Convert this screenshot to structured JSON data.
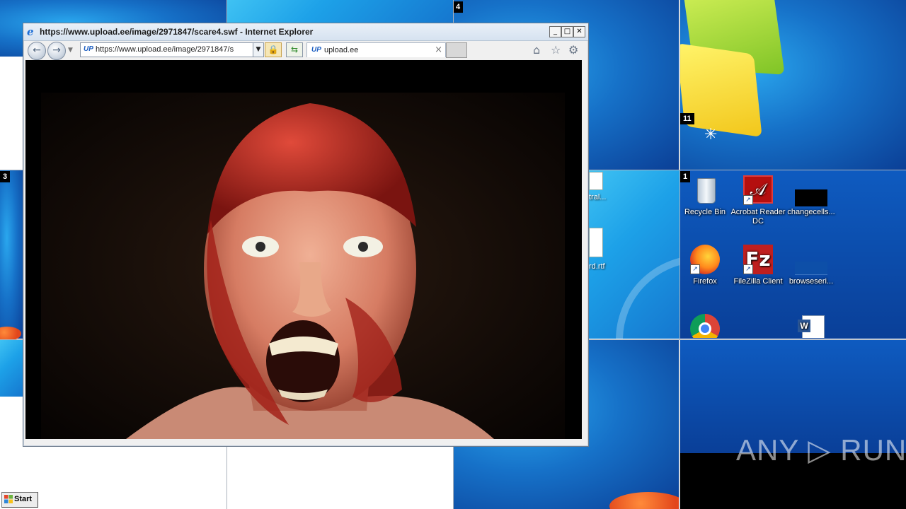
{
  "desktop": {
    "tile_numbers": [
      "4",
      "11",
      "3",
      "1"
    ],
    "icons": [
      {
        "label": "Recycle Bin",
        "icon": "recycle-bin-icon"
      },
      {
        "label": "Acrobat Reader DC",
        "icon": "acrobat-icon"
      },
      {
        "label": "changecells...",
        "icon": "file-icon"
      },
      {
        "label": "Firefox",
        "icon": "firefox-icon"
      },
      {
        "label": "FileZilla Client",
        "icon": "filezilla-icon"
      },
      {
        "label": "browseseri...",
        "icon": "file-icon"
      },
      {
        "label": "",
        "icon": "chrome-icon"
      },
      {
        "label": "",
        "icon": "word-doc-icon"
      }
    ],
    "partial_labels": [
      "tral...",
      "rd.rtf"
    ]
  },
  "ie_window": {
    "title": "https://www.upload.ee/image/2971847/scare4.swf - Internet Explorer",
    "address_url": "https://www.upload.ee/image/2971847/s",
    "tab_label": "upload.ee",
    "favicon_text": "UP",
    "window_buttons": {
      "minimize": "_",
      "maximize": "□",
      "close": "✕"
    }
  },
  "taskbar": {
    "start_label": "Start"
  },
  "watermark": {
    "text": "ANY ▷ RUN"
  }
}
